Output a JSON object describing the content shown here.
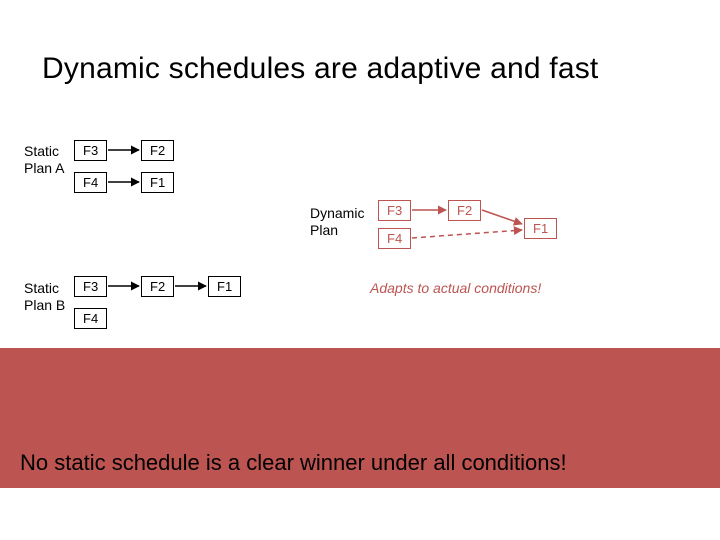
{
  "title": "Dynamic schedules are adaptive and fast",
  "staticA": {
    "label": "Static\nPlan A",
    "n1": "F3",
    "n2": "F2",
    "n3": "F4",
    "n4": "F1"
  },
  "staticB": {
    "label": "Static\nPlan B",
    "n1": "F3",
    "n2": "F2",
    "n3": "F1",
    "n4": "F4"
  },
  "dynamic": {
    "label": "Dynamic\nPlan",
    "n1": "F3",
    "n2": "F2",
    "n3": "F4",
    "n4": "F1"
  },
  "adapts": "Adapts to actual conditions!",
  "conclusion": "No static schedule is a clear winner under all conditions!"
}
